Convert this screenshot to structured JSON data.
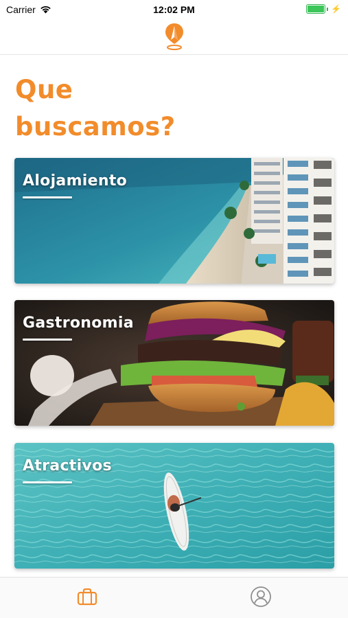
{
  "status_bar": {
    "carrier": "Carrier",
    "time": "12:02 PM",
    "battery_level": 1.0
  },
  "header": {
    "logo_icon": "compass-pin-logo"
  },
  "page": {
    "title_line1": "Que",
    "title_line2": "buscamos?"
  },
  "categories": [
    {
      "label": "Alojamiento",
      "image": "beach-hotel-photo"
    },
    {
      "label": "Gastronomia",
      "image": "burger-photo"
    },
    {
      "label": "Atractivos",
      "image": "paddleboard-ocean-photo"
    }
  ],
  "tab_bar": {
    "tabs": [
      {
        "icon": "briefcase-icon",
        "selected": true
      },
      {
        "icon": "user-icon",
        "selected": false
      }
    ]
  },
  "colors": {
    "accent": "#f28c2b",
    "tab_inactive": "#8e8e8e",
    "battery": "#3cc65a"
  }
}
